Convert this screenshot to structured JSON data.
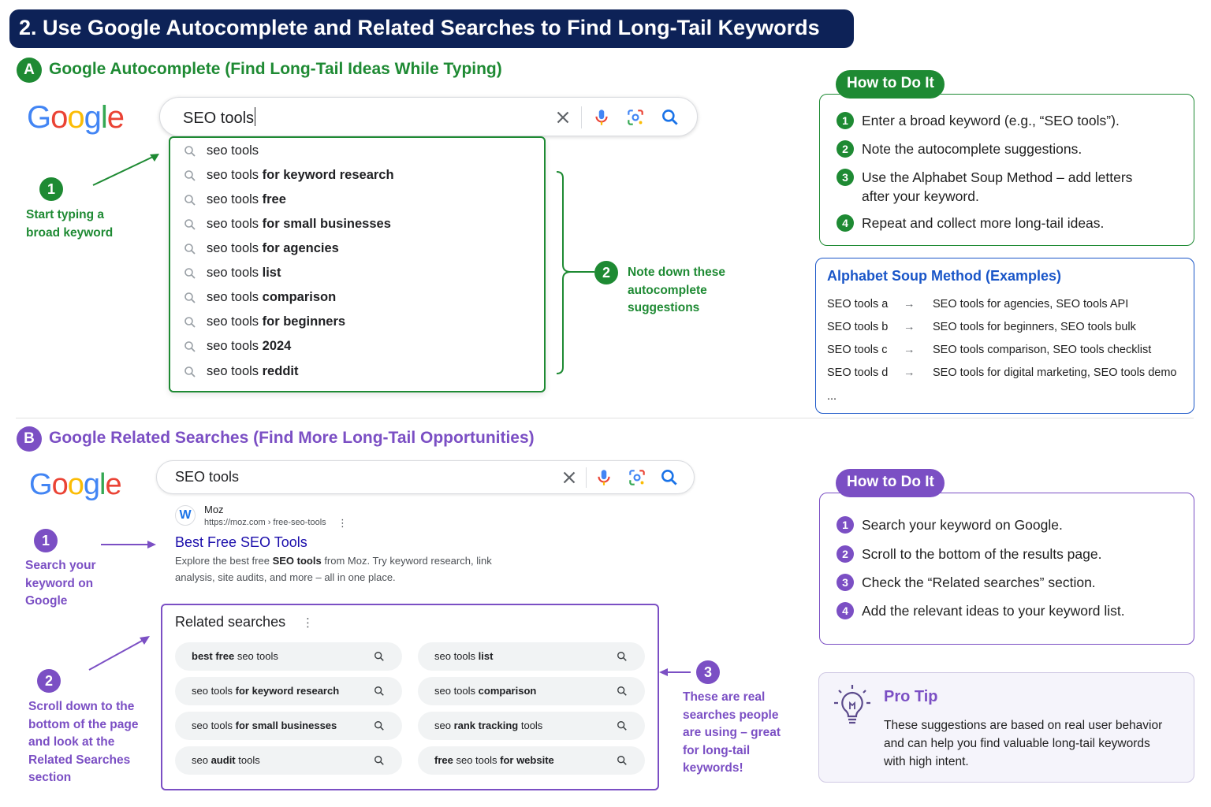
{
  "title": "2. Use Google Autocomplete and Related Searches to Find Long-Tail Keywords",
  "colors": {
    "navy": "#0d2257",
    "green": "#1e8a33",
    "purple": "#7b4fc4",
    "blue": "#1a56c8",
    "link": "#1a0dab"
  },
  "section_a": {
    "badge": "A",
    "title": "Google Autocomplete (Find Long-Tail Ideas While Typing)",
    "logo": [
      "G",
      "o",
      "o",
      "g",
      "l",
      "e"
    ],
    "search_value": "SEO tools",
    "suggestions": [
      {
        "base": "seo tools",
        "bold": ""
      },
      {
        "base": "seo tools",
        "bold": "for keyword research"
      },
      {
        "base": "seo tools",
        "bold": "free"
      },
      {
        "base": "seo tools",
        "bold": "for small businesses"
      },
      {
        "base": "seo tools",
        "bold": "for agencies"
      },
      {
        "base": "seo tools",
        "bold": "list"
      },
      {
        "base": "seo tools",
        "bold": "comparison"
      },
      {
        "base": "seo tools",
        "bold": "for beginners"
      },
      {
        "base": "seo tools",
        "bold": "2024"
      },
      {
        "base": "seo tools",
        "bold": "reddit"
      }
    ],
    "step1": {
      "num": "1",
      "line1": "Start typing a",
      "line2": "broad keyword"
    },
    "step2": {
      "num": "2",
      "line1": "Note down these",
      "line2": "autocomplete",
      "line3": "suggestions"
    },
    "howto": {
      "tab": "How to Do It",
      "items": [
        {
          "num": "1",
          "line1": "Enter a broad keyword (e.g., “SEO tools”).",
          "line2": ""
        },
        {
          "num": "2",
          "line1": "Note the autocomplete suggestions.",
          "line2": ""
        },
        {
          "num": "3",
          "line1": "Use the Alphabet Soup Method – add letters",
          "line2": "after your keyword."
        },
        {
          "num": "4",
          "line1": "Repeat and collect more long-tail ideas.",
          "line2": ""
        }
      ]
    },
    "alphabet": {
      "title": "Alphabet Soup Method (Examples)",
      "arrow": "→",
      "rows": [
        {
          "k": "SEO tools a",
          "v": "SEO tools for agencies, SEO tools API"
        },
        {
          "k": "SEO tools b",
          "v": "SEO tools for beginners, SEO tools bulk"
        },
        {
          "k": "SEO tools c",
          "v": "SEO tools comparison, SEO tools checklist"
        },
        {
          "k": "SEO tools d",
          "v": "SEO tools for digital marketing, SEO tools demo"
        }
      ],
      "more": "..."
    }
  },
  "section_b": {
    "badge": "B",
    "title": "Google Related Searches (Find More Long-Tail Opportunities)",
    "logo": [
      "G",
      "o",
      "o",
      "g",
      "l",
      "e"
    ],
    "search_value": "SEO tools",
    "result": {
      "favicon": "W",
      "site": "Moz",
      "url": "https://moz.com › free-seo-tools",
      "menu": "⋮",
      "title": "Best Free SEO Tools",
      "snippet_pre": "Explore the best free ",
      "snippet_bold": "SEO tools",
      "snippet_post": " from Moz. Try keyword research, link",
      "snippet_line2": "analysis, site audits, and more – all in one place."
    },
    "related": {
      "title": "Related searches",
      "menu": "⋮",
      "left": [
        {
          "b1": "best free",
          "n1": " seo tools",
          "b2": ""
        },
        {
          "b1": "",
          "n1": "seo tools ",
          "b2": "for keyword research"
        },
        {
          "b1": "",
          "n1": "seo tools ",
          "b2": "for small businesses"
        },
        {
          "b1": "",
          "n1": "seo ",
          "b2": "audit",
          "n2": " tools"
        }
      ],
      "right": [
        {
          "b1": "",
          "n1": "seo tools ",
          "b2": "list"
        },
        {
          "b1": "",
          "n1": "seo tools ",
          "b2": "comparison"
        },
        {
          "b1": "",
          "n1": "seo ",
          "b2": "rank tracking",
          "n2": " tools"
        },
        {
          "b1": "free",
          "n1": " seo tools ",
          "b2": "for website"
        }
      ]
    },
    "step1": {
      "num": "1",
      "line1": "Search your",
      "line2": "keyword on",
      "line3": "Google"
    },
    "step2": {
      "num": "2",
      "line1": "Scroll down to the",
      "line2": "bottom of the page",
      "line3": "and look at the",
      "line4": "Related Searches",
      "line5": "section"
    },
    "step3": {
      "num": "3",
      "line1": "These are real",
      "line2": "searches people",
      "line3": "are using – great",
      "line4": "for long-tail",
      "line5": "keywords!"
    },
    "howto": {
      "tab": "How to Do It",
      "items": [
        {
          "num": "1",
          "text": "Search your keyword on Google."
        },
        {
          "num": "2",
          "text": "Scroll to the bottom of the results page."
        },
        {
          "num": "3",
          "text": "Check the “Related searches” section."
        },
        {
          "num": "4",
          "text": "Add the relevant ideas to your keyword list."
        }
      ]
    },
    "protip": {
      "title": "Pro Tip",
      "line1": "These suggestions are based on real user behavior",
      "line2": "and can help you find valuable long-tail keywords",
      "line3": "with high intent."
    }
  }
}
